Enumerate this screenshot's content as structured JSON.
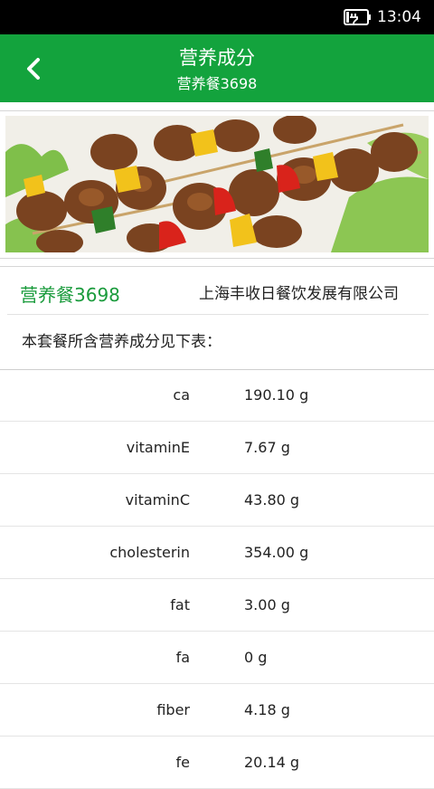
{
  "status_bar": {
    "time": "13:04",
    "battery_icon": "battery-charging-icon"
  },
  "header": {
    "back_icon": "chevron-left-icon",
    "title": "营养成分",
    "subtitle": "营养餐3698",
    "background_color": "#13a33d"
  },
  "banner": {
    "image": "grilled-meat-skewers-photo"
  },
  "info": {
    "meal_name": "营养餐3698",
    "company": "上海丰收日餐饮发展有限公司",
    "intro": "本套餐所含营养成分见下表：",
    "accent_color": "#1a9b3c"
  },
  "nutrients": [
    {
      "name": "ca",
      "value": "190.10 g"
    },
    {
      "name": "vitaminE",
      "value": "7.67 g"
    },
    {
      "name": "vitaminC",
      "value": "43.80 g"
    },
    {
      "name": "cholesterin",
      "value": "354.00 g"
    },
    {
      "name": "fat",
      "value": "3.00 g"
    },
    {
      "name": "fa",
      "value": "0 g"
    },
    {
      "name": "fiber",
      "value": "4.18 g"
    },
    {
      "name": "fe",
      "value": "20.14 g"
    }
  ]
}
